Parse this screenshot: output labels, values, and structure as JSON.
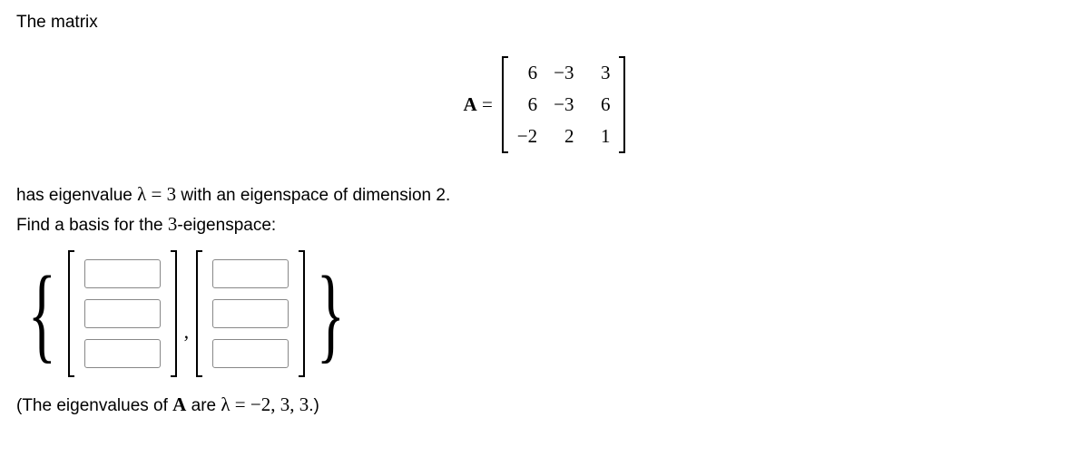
{
  "text": {
    "intro": "The matrix",
    "eq_label_left": "A",
    "eq_label_eq": " = ",
    "line1_a": "has eigenvalue ",
    "line1_b": "λ = 3",
    "line1_c": " with an eigenspace of dimension 2.",
    "line2": "Find a basis for the ",
    "line2_b": "3",
    "line2_c": "-eigenspace:",
    "footnote_a": "(The eigenvalues of ",
    "footnote_b": "A",
    "footnote_c": " are ",
    "footnote_d": "λ = −2, 3, 3",
    "footnote_e": ".)",
    "comma": ","
  },
  "matrix": {
    "rows": [
      [
        "6",
        "−3",
        "3"
      ],
      [
        "6",
        "−3",
        "6"
      ],
      [
        "−2",
        "2",
        "1"
      ]
    ]
  },
  "inputs": {
    "v1": [
      "",
      "",
      ""
    ],
    "v2": [
      "",
      "",
      ""
    ]
  }
}
